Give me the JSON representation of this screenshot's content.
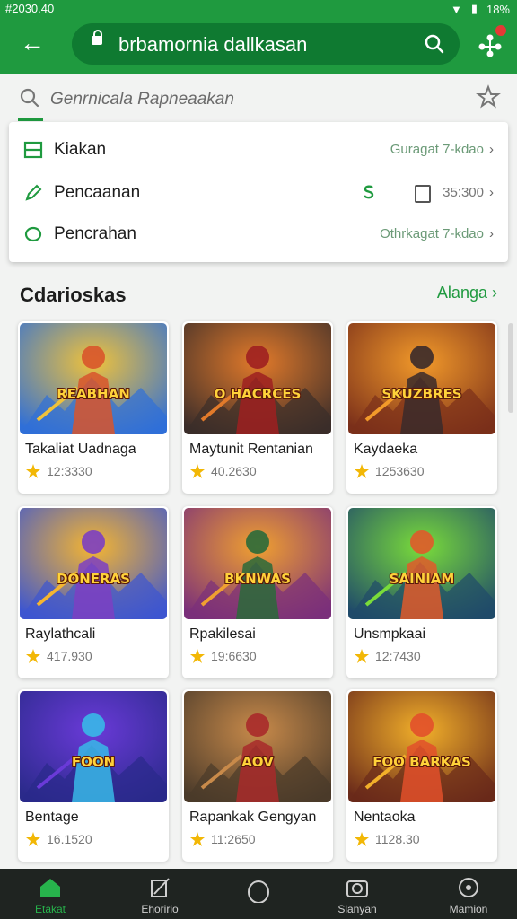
{
  "status_bar": {
    "left_text": "#2030.40",
    "right_text": "18%"
  },
  "app_bar": {
    "url": "brbamornia dallkasan",
    "notification_dot_color": "#e53935"
  },
  "search": {
    "placeholder": "Genrnicala Rapneaakan"
  },
  "menu": [
    {
      "label": "Kiakan",
      "right": "Guragat 7-kdao",
      "icon": "square-list-icon"
    },
    {
      "label": "Pencaanan",
      "right": "35:300",
      "icon": "pencil-icon"
    },
    {
      "label": "Pencrahan",
      "right": "Othrkagat 7-kdao",
      "icon": "circle-icon"
    }
  ],
  "section": {
    "title": "Cdarioskas",
    "link": "Alanga"
  },
  "games": [
    {
      "title": "Takaliat Uadnaga",
      "rating": "12:3330",
      "art_text": "REABHAN",
      "palette": [
        "#2f6fd8",
        "#f0c23a",
        "#d8552b"
      ]
    },
    {
      "title": "Maytunit Rentanian",
      "rating": "40.2630",
      "art_text": "O HACRCES",
      "palette": [
        "#3b2d2a",
        "#e27a2a",
        "#9e2020"
      ]
    },
    {
      "title": "Kaydaeka",
      "rating": "1253630",
      "art_text": "SKUZBRES",
      "palette": [
        "#7a2f1a",
        "#f29a2a",
        "#3a2a2a"
      ]
    },
    {
      "title": "Raylathcali",
      "rating": "417.930",
      "art_text": "DONERAS",
      "palette": [
        "#3d56d0",
        "#f5b530",
        "#7c3fc2"
      ]
    },
    {
      "title": "Rpakilesai",
      "rating": "19:6630",
      "art_text": "BKNWAS",
      "palette": [
        "#7a2f7a",
        "#f0a030",
        "#2a6a3a"
      ]
    },
    {
      "title": "Unsmpkaai",
      "rating": "12:7430",
      "art_text": "SAINIAM",
      "palette": [
        "#1f4a6a",
        "#7adc3a",
        "#e05a2a"
      ]
    },
    {
      "title": "Bentage",
      "rating": "16.1520",
      "art_text": "FOON",
      "palette": [
        "#2a2a8a",
        "#6a3ad8",
        "#38b8e8"
      ]
    },
    {
      "title": "Rapankak Gengyan",
      "rating": "11:2650",
      "art_text": "AOV",
      "palette": [
        "#4a3a2a",
        "#c88a4a",
        "#a82a2a"
      ]
    },
    {
      "title": "Nentaoka",
      "rating": "1128.30",
      "art_text": "FOO BARKAS",
      "palette": [
        "#6a2a1a",
        "#f2b02a",
        "#e2502a"
      ]
    }
  ],
  "bottom_nav": [
    {
      "label": "Etakat",
      "icon": "home-icon",
      "active": true
    },
    {
      "label": "Ehoririo",
      "icon": "edit-icon",
      "active": false
    },
    {
      "label": "",
      "icon": "circle-outline-icon",
      "active": false
    },
    {
      "label": "Slanyan",
      "icon": "camera-icon",
      "active": false
    },
    {
      "label": "Mamion",
      "icon": "target-icon",
      "active": false
    }
  ],
  "colors": {
    "brand_green": "#1f9a3f",
    "dark_green": "#0f7a31",
    "nav_bg": "#1f2421"
  }
}
